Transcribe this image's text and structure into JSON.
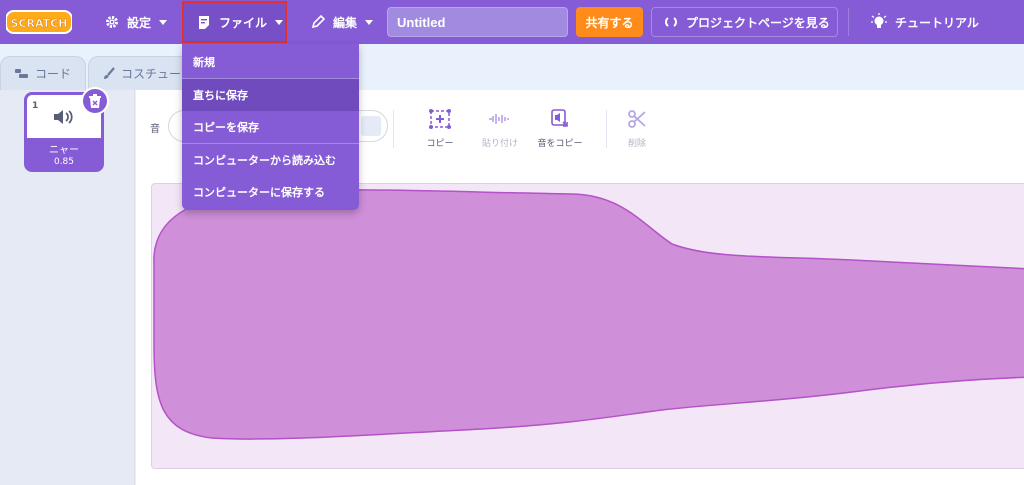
{
  "menubar": {
    "logo_text": "SCRATCH",
    "settings_label": "設定",
    "file_label": "ファイル",
    "edit_label": "編集",
    "project_title": "Untitled",
    "share_label": "共有する",
    "project_page_label": "プロジェクトページを見る",
    "tutorials_label": "チュートリアル"
  },
  "file_menu": {
    "items": [
      "新規",
      "直ちに保存",
      "コピーを保存",
      "コンピューターから読み込む",
      "コンピューターに保存する"
    ],
    "hovered_index": 1
  },
  "tabs": [
    {
      "label": "コード",
      "icon": "code-icon"
    },
    {
      "label": "コスチュー",
      "icon": "brush-icon"
    }
  ],
  "sound_list": [
    {
      "index": "1",
      "name": "ニャー",
      "duration": "0.85"
    }
  ],
  "editor": {
    "sound_label": "音",
    "tools": [
      {
        "label": "コピー",
        "icon": "copy-icon",
        "enabled": true
      },
      {
        "label": "貼り付け",
        "icon": "paste-icon",
        "enabled": false
      },
      {
        "label": "音をコピー",
        "icon": "copy-to-new-icon",
        "enabled": true
      },
      {
        "label": "削除",
        "icon": "scissors-icon",
        "enabled": false
      }
    ]
  },
  "colors": {
    "menubar": "#855cd6",
    "share": "#ff8c1a",
    "waveform_fill": "#cf8fd9",
    "waveform_stroke": "#b452c7",
    "highlight_border": "#e03030"
  }
}
